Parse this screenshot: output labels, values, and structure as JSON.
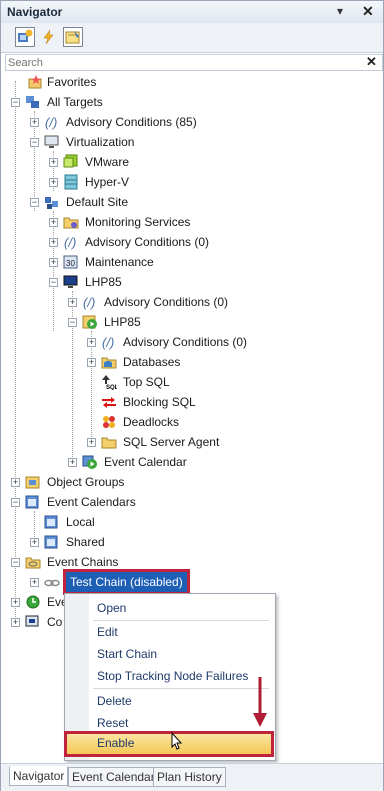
{
  "window": {
    "title": "Navigator",
    "pin_glyph": "▾",
    "close_glyph": "✕"
  },
  "toolbar": {
    "buttons": [
      "add-target-icon",
      "lightning-icon",
      "event-calendar-icon"
    ]
  },
  "search": {
    "placeholder": "Search",
    "clear_glyph": "✕"
  },
  "tree": {
    "favorites": "Favorites",
    "all_targets": "All Targets",
    "advisory_85": "Advisory Conditions (85)",
    "virtualization": "Virtualization",
    "vmware": "VMware",
    "hyperv": "Hyper-V",
    "default_site": "Default Site",
    "monitoring_services": "Monitoring Services",
    "advisory_0a": "Advisory Conditions (0)",
    "maintenance": "Maintenance",
    "lhp85_host": "LHP85",
    "advisory_0b": "Advisory Conditions (0)",
    "lhp85_instance": "LHP85",
    "advisory_0c": "Advisory Conditions (0)",
    "databases": "Databases",
    "top_sql": "Top SQL",
    "blocking_sql": "Blocking SQL",
    "deadlocks": "Deadlocks",
    "sql_server_agent": "SQL Server Agent",
    "event_calendar": "Event Calendar",
    "object_groups": "Object Groups",
    "event_calendars": "Event Calendars",
    "local": "Local",
    "shared": "Shared",
    "event_chains": "Event Chains",
    "test_chain": "Test Chain (disabled)",
    "partial_eve": "Eve",
    "partial_co": "Co"
  },
  "context_menu": {
    "open": "Open",
    "edit": "Edit",
    "start_chain": "Start Chain",
    "stop_tracking": "Stop Tracking Node Failures",
    "delete": "Delete",
    "reset": "Reset",
    "enable": "Enable"
  },
  "tabs": [
    "Navigator",
    "Event Calendar",
    "Plan History"
  ],
  "colors": {
    "selection": "#1e5fb6",
    "highlight_border": "#c0233c",
    "enable_bg": "#f4c857"
  }
}
